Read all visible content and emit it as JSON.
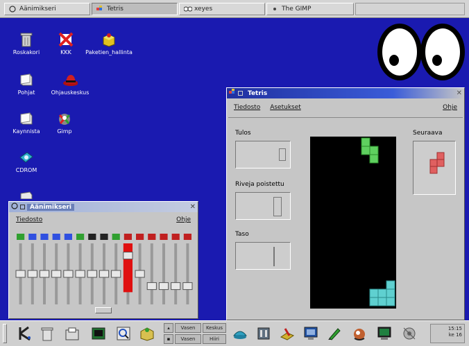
{
  "top_taskbar": {
    "items": [
      {
        "label": "Aänimikseri",
        "icon": "mixer-icon"
      },
      {
        "label": "Tetris",
        "icon": "tetris-icon"
      },
      {
        "label": "xeyes",
        "icon": "eyes-icon"
      },
      {
        "label": "The GIMP",
        "icon": "gimp-icon"
      }
    ],
    "active_index": 1
  },
  "desktop": {
    "background": "#1a1ab0",
    "icons": [
      {
        "label": "Roskakori",
        "icon": "trash-icon"
      },
      {
        "label": "KKK",
        "icon": "crossed-out-icon"
      },
      {
        "label": "Paketien_hallinta",
        "icon": "package-icon"
      },
      {
        "label": "Pohjat",
        "icon": "folder-icon"
      },
      {
        "label": "Ohjauskeskus",
        "icon": "hat-icon"
      },
      {
        "label": "Kaynnista",
        "icon": "folder-icon"
      },
      {
        "label": "Gimp",
        "icon": "gimp-icon"
      },
      {
        "label": "CDROM",
        "icon": "cdrom-icon"
      }
    ]
  },
  "mixer": {
    "title": "Aänimikseri",
    "menu": {
      "file": "Tiedosto",
      "help": "Ohje"
    },
    "channel_count": 15,
    "levels": [
      0.5,
      0.5,
      0.5,
      0.5,
      0.5,
      0.5,
      0.5,
      0.5,
      0.5,
      0.8,
      0.5,
      0.3,
      0.3,
      0.3,
      0.3
    ],
    "red_channel_index": 9
  },
  "tetris": {
    "title": "Tetris",
    "menu": {
      "game": "Tiedosto",
      "settings": "Asetukset",
      "help": "Ohje"
    },
    "labels": {
      "score": "Tulos",
      "lines": "Riveja poistettu",
      "level": "Taso",
      "next": "Seuraava"
    },
    "values": {
      "score": "0",
      "lines": "0",
      "level": "1"
    },
    "colors": {
      "falling": "#5fd05f",
      "landed": "#5fd0d0",
      "next": "#e06060"
    }
  },
  "bottom_taskbar": {
    "pager": [
      {
        "label": "Vasen"
      },
      {
        "label": "Keskus"
      },
      {
        "label": "Vasen"
      },
      {
        "label": "Hiiri"
      }
    ],
    "launchers": [
      {
        "icon": "k-menu-icon"
      },
      {
        "icon": "trash-icon"
      },
      {
        "icon": "file-manager-icon"
      },
      {
        "icon": "terminal-icon"
      },
      {
        "icon": "search-icon"
      },
      {
        "icon": "package-icon"
      },
      {
        "icon": "shell-icon"
      },
      {
        "icon": "mixer-icon"
      },
      {
        "icon": "settings-icon"
      },
      {
        "icon": "window-list-icon"
      },
      {
        "icon": "edit-icon"
      },
      {
        "icon": "gimp-icon"
      },
      {
        "icon": "monitor-icon"
      },
      {
        "icon": "network-icon"
      }
    ],
    "clock": {
      "time": "15:15",
      "date": "ke 16"
    }
  }
}
